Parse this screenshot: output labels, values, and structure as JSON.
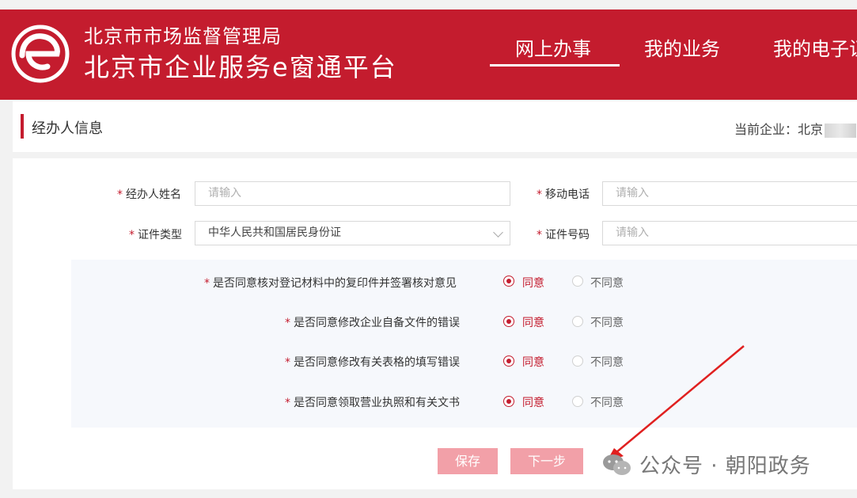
{
  "header": {
    "org_name": "北京市市场监督管理局",
    "platform_name": "北京市企业服务e窗通平台",
    "nav": [
      {
        "label": "网上办事",
        "active": true
      },
      {
        "label": "我的业务",
        "active": false
      },
      {
        "label": "我的电子证",
        "active": false
      }
    ]
  },
  "titlebar": {
    "title": "经办人信息",
    "company_label": "当前企业：北京"
  },
  "form": {
    "agent_name": {
      "label": "经办人姓名",
      "placeholder": "请输入"
    },
    "mobile": {
      "label": "移动电话",
      "placeholder": "请输入"
    },
    "id_type": {
      "label": "证件类型",
      "value": "中华人民共和国居民身份证"
    },
    "id_number": {
      "label": "证件号码",
      "placeholder": "请输入"
    }
  },
  "consent": {
    "agree_label": "同意",
    "disagree_label": "不同意",
    "questions": [
      {
        "text": "是否同意核对登记材料中的复印件并签署核对意见",
        "agreed": true
      },
      {
        "text": "是否同意修改企业自备文件的错误",
        "agreed": true
      },
      {
        "text": "是否同意修改有关表格的填写错误",
        "agreed": true
      },
      {
        "text": "是否同意领取营业执照和有关文书",
        "agreed": true
      }
    ]
  },
  "buttons": {
    "save": "保存",
    "next": "下一步"
  },
  "watermark": {
    "text": "公众号 · 朝阳政务"
  },
  "colors": {
    "brand_red": "#c41c2e",
    "button_disabled": "#f2a0a8",
    "consent_bg": "#f6f8fc"
  }
}
